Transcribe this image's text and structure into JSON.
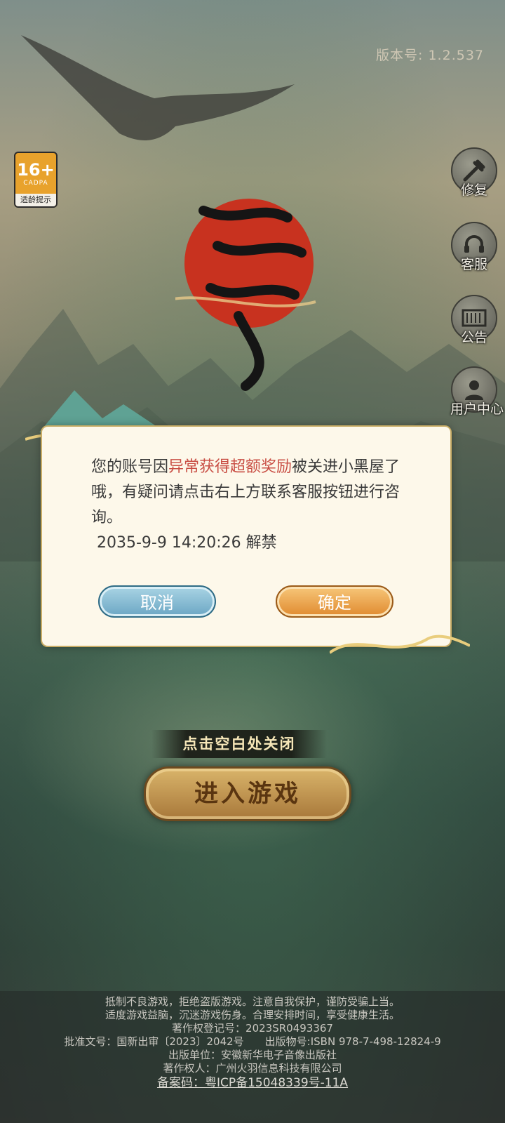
{
  "header": {
    "version_text": "版本号: 1.2.537"
  },
  "age_rating": {
    "rating": "16+",
    "org": "CADPA",
    "tip": "适龄提示"
  },
  "side_menu": [
    {
      "label": "修复",
      "icon": "wrench-hammer-icon"
    },
    {
      "label": "客服",
      "icon": "headset-icon"
    },
    {
      "label": "公告",
      "icon": "notice-board-icon"
    },
    {
      "label": "用户中心",
      "icon": "user-avatar-icon"
    }
  ],
  "dialog": {
    "line_pre": "您的账号因",
    "highlight": "异常获得超额奖励",
    "line_post": "被关进小黑屋了哦，有疑问请点击右上方联系客服按钮进行咨询。",
    "unban_text": "2035-9-9 14:20:26 解禁",
    "cancel_label": "取消",
    "confirm_label": "确定",
    "highlight_color": "#c94f45"
  },
  "close_hint": "点击空白处关闭",
  "enter_button": "进入游戏",
  "footer": {
    "lines": [
      "抵制不良游戏，拒绝盗版游戏。注意自我保护，谨防受骗上当。",
      "适度游戏益脑，沉迷游戏伤身。合理安排时间，享受健康生活。",
      "著作权登记号：2023SR0493367",
      "批准文号：国新出审〔2023〕2042号　　出版物号:ISBN 978-7-498-12824-9",
      "出版单位：安徽新华电子音像出版社",
      "著作权人：广州火羽信息科技有限公司"
    ],
    "icp": "备案码：粤ICP备15048339号-11A"
  }
}
